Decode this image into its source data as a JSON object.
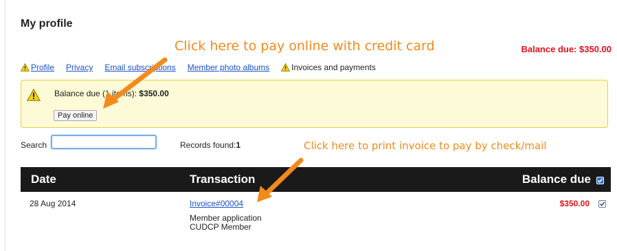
{
  "page": {
    "title": "My profile",
    "balance_summary": "Balance due: $350.00"
  },
  "annotations": {
    "pay_online_callout": "Click here to pay online with credit card",
    "print_invoice_callout": "Click here to print invoice to pay by check/mail",
    "color": "#f38a1b"
  },
  "tabs": [
    {
      "label": "Profile",
      "icon": "warning-icon"
    },
    {
      "label": "Privacy"
    },
    {
      "label": "Email subscriptions"
    },
    {
      "label": "Member photo albums"
    },
    {
      "label": "Invoices and payments",
      "icon": "warning-icon",
      "active": true
    }
  ],
  "alert": {
    "text_prefix": "Balance due (1 items): ",
    "amount": "$350.00",
    "icon": "warning-icon",
    "pay_button": "Pay online"
  },
  "search": {
    "label": "Search",
    "value": ""
  },
  "records": {
    "label": "Records found:",
    "count": "1"
  },
  "table": {
    "columns": [
      "Date",
      "Transaction",
      "Balance due"
    ],
    "header_checkbox_checked": true,
    "rows": [
      {
        "date": "28 Aug 2014",
        "invoice": "Invoice#00004",
        "description": [
          "Member application",
          "CUDCP Member"
        ],
        "balance": "$350.00",
        "checked": true
      }
    ]
  },
  "colors": {
    "accent_link": "#1a4fc4",
    "amount_red": "#e0101b",
    "alert_background": "#fdfad7",
    "alert_border": "#e9cf3a",
    "table_header": "#1a1a1a"
  }
}
